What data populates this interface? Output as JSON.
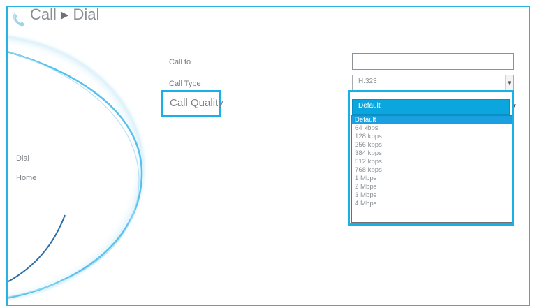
{
  "header": {
    "section": "Call",
    "page": "Dial",
    "separator": "▶",
    "icon": "phone-icon"
  },
  "nav": {
    "items": [
      {
        "label": "Dial"
      },
      {
        "label": "Home"
      }
    ]
  },
  "form": {
    "call_to": {
      "label": "Call to",
      "value": ""
    },
    "call_type": {
      "label": "Call Type",
      "value": "H.323"
    },
    "call_quality": {
      "label": "Call Quality",
      "value": "Default",
      "options": [
        "Default",
        "64 kbps",
        "128 kbps",
        "256 kbps",
        "384 kbps",
        "512 kbps",
        "768 kbps",
        "1 Mbps",
        "2 Mbps",
        "3 Mbps",
        "4 Mbps"
      ],
      "selected_index": 0
    }
  },
  "colors": {
    "accent": "#18b0e6",
    "selected_bg": "#1a9fe0",
    "text": "#7a7f84"
  }
}
